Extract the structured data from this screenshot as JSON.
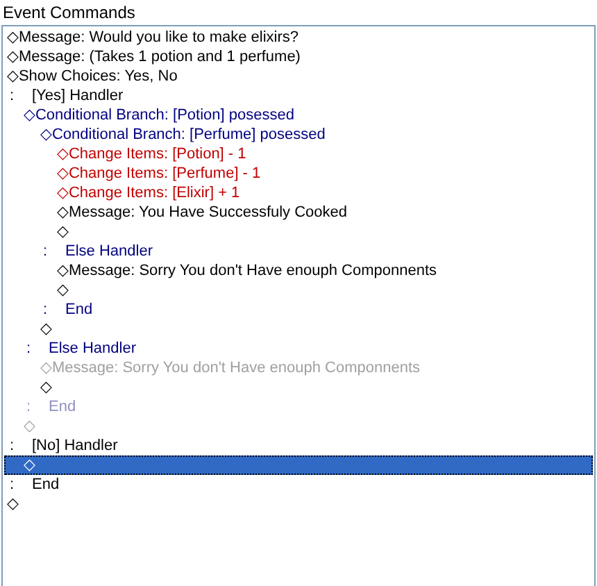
{
  "panel": {
    "title": "Event Commands"
  },
  "items": [
    {
      "kind": "command",
      "marker": "◇",
      "text": "Message: Would you like to make elixirs?",
      "color": "#000000",
      "selected": false
    },
    {
      "kind": "command",
      "marker": "◇",
      "text": "Message: (Takes 1 potion and 1 perfume)",
      "color": "#000000",
      "selected": false
    },
    {
      "kind": "command",
      "marker": "◇",
      "text": "Show Choices: Yes, No",
      "color": "#000000",
      "selected": false
    },
    {
      "kind": "handler",
      "marker": ":",
      "text": "[Yes] Handler",
      "color": "#000000",
      "selected": false,
      "children": [
        {
          "kind": "command",
          "marker": "◇",
          "text": "Conditional Branch: [Potion] posessed",
          "color": "#000080",
          "selected": false,
          "children": [
            {
              "kind": "command",
              "marker": "◇",
              "text": "Conditional Branch: [Perfume] posessed",
              "color": "#000080",
              "selected": false,
              "children": [
                {
                  "kind": "command",
                  "marker": "◇",
                  "text": "Change Items: [Potion] - 1",
                  "color": "#c00000",
                  "selected": false
                },
                {
                  "kind": "command",
                  "marker": "◇",
                  "text": "Change Items: [Perfume] - 1",
                  "color": "#c00000",
                  "selected": false
                },
                {
                  "kind": "command",
                  "marker": "◇",
                  "text": "Change Items: [Elixir] + 1",
                  "color": "#c00000",
                  "selected": false
                },
                {
                  "kind": "command",
                  "marker": "◇",
                  "text": "Message: You Have Successfuly Cooked",
                  "color": "#000000",
                  "selected": false
                },
                {
                  "kind": "command",
                  "marker": "◇",
                  "color": "#000000",
                  "selected": false
                }
              ]
            },
            {
              "kind": "handler",
              "marker": ":",
              "text": "Else Handler",
              "color": "#000080",
              "selected": false,
              "children": [
                {
                  "kind": "command",
                  "marker": "◇",
                  "text": "Message: Sorry You don't Have enouph Componnents",
                  "color": "#000000",
                  "selected": false
                },
                {
                  "kind": "command",
                  "marker": "◇",
                  "color": "#000000",
                  "selected": false
                }
              ]
            },
            {
              "kind": "handler",
              "marker": ":",
              "text": "End",
              "color": "#000080",
              "selected": false
            },
            {
              "kind": "command",
              "marker": "◇",
              "color": "#000000",
              "selected": false
            }
          ]
        },
        {
          "kind": "handler",
          "marker": ":",
          "text": "Else Handler",
          "color": "#000080",
          "selected": false,
          "children": [
            {
              "kind": "command",
              "marker": "◇",
              "text": "Message: Sorry You don't Have enouph Componnents",
              "color": "#a0a0a0",
              "selected": false
            },
            {
              "kind": "command",
              "marker": "◇",
              "color": "#000000",
              "selected": false
            }
          ]
        },
        {
          "kind": "handler",
          "marker": ":",
          "text": "End",
          "color": "#9090c0",
          "selected": false
        },
        {
          "kind": "command",
          "marker": "◇",
          "color": "#a0a0a0",
          "selected": false
        }
      ]
    },
    {
      "kind": "handler",
      "marker": ":",
      "text": "[No] Handler",
      "color": "#000000",
      "selected": false,
      "children": [
        {
          "kind": "command",
          "marker": "◇",
          "color": "#000000",
          "selected": true
        }
      ]
    },
    {
      "kind": "handler",
      "marker": ":",
      "text": "End",
      "color": "#000000",
      "selected": false
    },
    {
      "kind": "command",
      "marker": "◇",
      "color": "#000000",
      "selected": false
    }
  ]
}
